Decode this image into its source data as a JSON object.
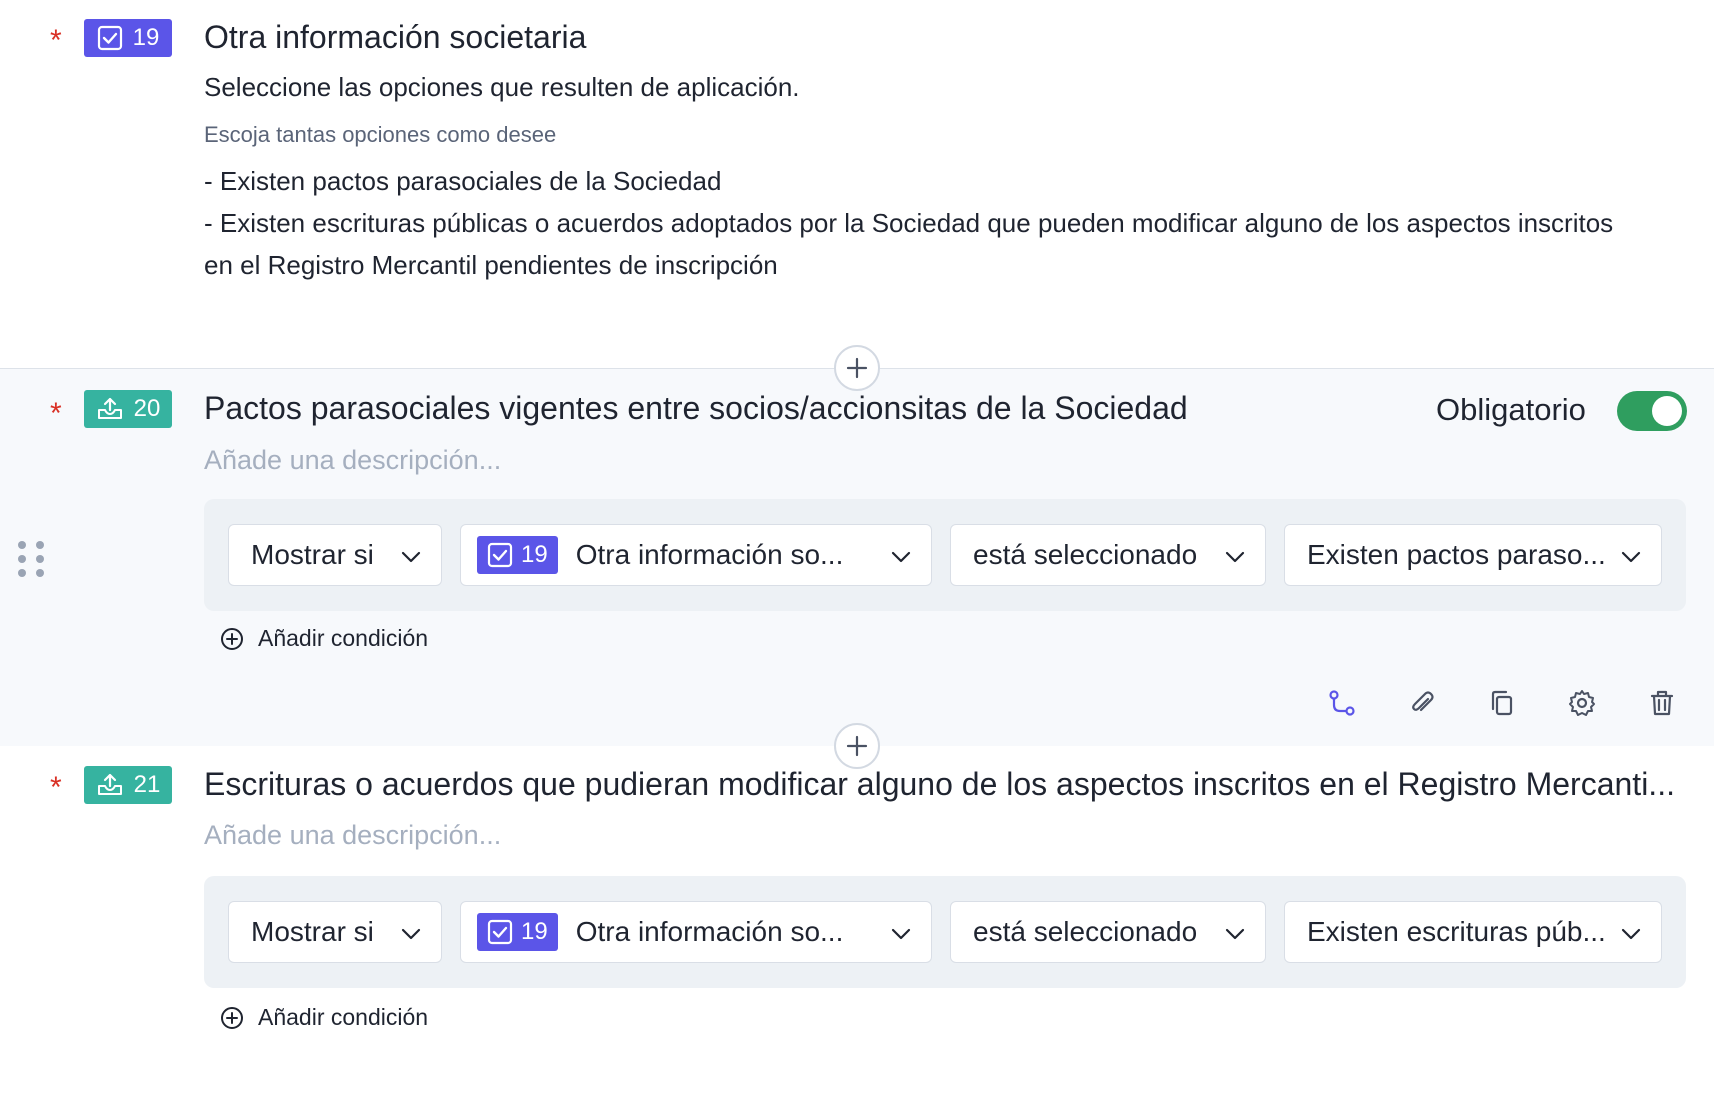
{
  "colors": {
    "required_star": "#d93025",
    "badge_checkbox": "#5b55e8",
    "badge_upload": "#36b3a0",
    "toggle_on": "#2f9e5f"
  },
  "questions": [
    {
      "number": "19",
      "icon": "checkbox-icon",
      "title": "Otra información societaria",
      "subtitle": "Seleccione las opciones que resulten de aplicación.",
      "hint": "Escoja tantas opciones como desee",
      "options": [
        "- Existen pactos parasociales de la Sociedad",
        "- Existen escrituras públicas o acuerdos adoptados por la Sociedad que pueden modificar alguno de los aspectos inscritos en el Registro Mercantil pendientes de inscripción"
      ]
    },
    {
      "number": "20",
      "icon": "upload-icon",
      "title": "Pactos parasociales vigentes entre socios/accionsitas de la Sociedad",
      "description_placeholder": "Añade una descripción...",
      "required_label": "Obligatorio",
      "required": true,
      "condition": {
        "show_if": "Mostrar si",
        "question_number": "19",
        "question_title": "Otra información so...",
        "operator": "está seleccionado",
        "value": "Existen pactos paraso..."
      },
      "add_condition": "Añadir condición"
    },
    {
      "number": "21",
      "icon": "upload-icon",
      "title": "Escrituras o acuerdos que pudieran modificar alguno de los aspectos inscritos en el Registro Mercanti...",
      "description_placeholder": "Añade una descripción...",
      "condition": {
        "show_if": "Mostrar si",
        "question_number": "19",
        "question_title": "Otra información so...",
        "operator": "está seleccionado",
        "value": "Existen escrituras púb..."
      },
      "add_condition": "Añadir condición"
    }
  ],
  "toolbar": [
    "branch-icon",
    "paperclip-icon",
    "copy-icon",
    "gear-icon",
    "trash-icon"
  ]
}
